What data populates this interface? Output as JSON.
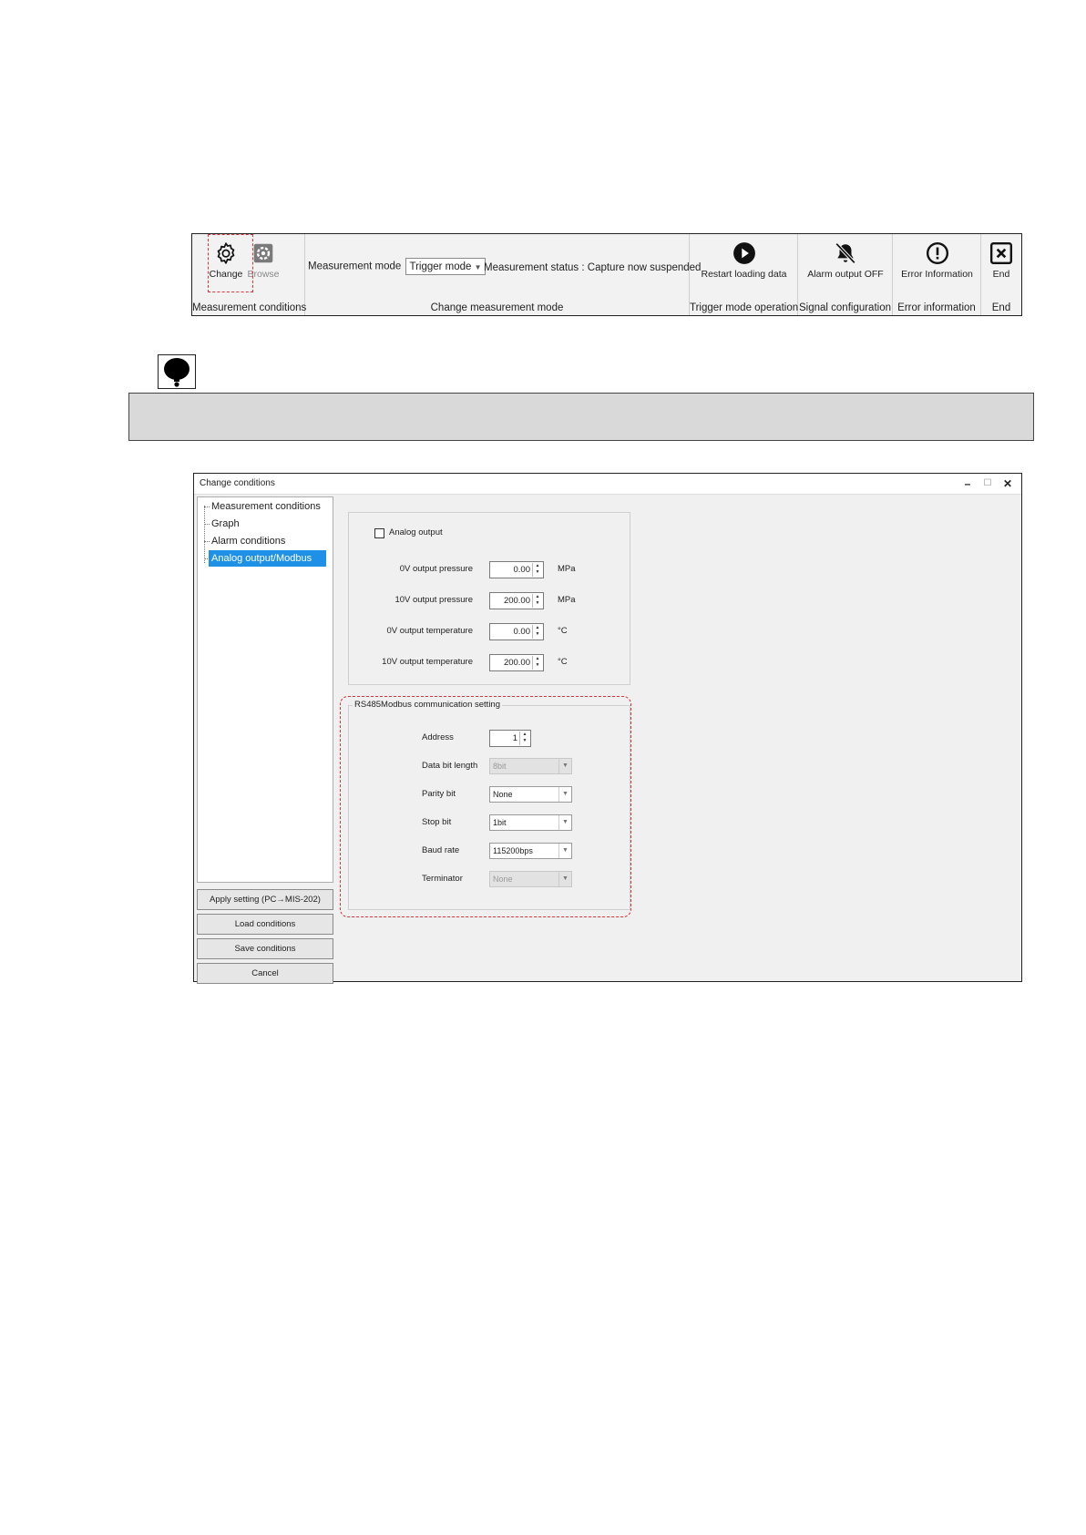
{
  "ribbon": {
    "change_label": "Change",
    "browse_label": "Browse",
    "group_measurement_conditions": "Measurement conditions",
    "measurement_mode_label": "Measurement mode",
    "measurement_mode_value": "Trigger mode",
    "measurement_status": "Measurement status : Capture now suspended",
    "group_change_measurement_mode": "Change measurement mode",
    "restart_label": "Restart loading data",
    "group_trigger_mode_operation": "Trigger mode operation",
    "alarm_label": "Alarm output OFF",
    "group_signal_configuration": "Signal configuration",
    "error_label": "Error Information",
    "group_error_information": "Error information",
    "end_label": "End",
    "group_end": "End"
  },
  "dialog": {
    "title": "Change conditions",
    "tree": [
      "Measurement conditions",
      "Graph",
      "Alarm conditions",
      "Analog output/Modbus"
    ],
    "buttons": {
      "apply": "Apply setting (PC→MIS-202)",
      "load": "Load conditions",
      "save": "Save conditions",
      "cancel": "Cancel"
    },
    "analog": {
      "checkbox_label": "Analog output",
      "checked": false,
      "rows": [
        {
          "label": "0V output pressure",
          "value": "0.00",
          "unit": "MPa"
        },
        {
          "label": "10V output pressure",
          "value": "200.00",
          "unit": "MPa"
        },
        {
          "label": "0V output temperature",
          "value": "0.00",
          "unit": "°C"
        },
        {
          "label": "10V output temperature",
          "value": "200.00",
          "unit": "°C"
        }
      ]
    },
    "rs485": {
      "legend": "RS485Modbus communication setting",
      "address_label": "Address",
      "address_value": "1",
      "data_bit_label": "Data bit length",
      "data_bit_value": "8bit",
      "parity_label": "Parity bit",
      "parity_value": "None",
      "stop_label": "Stop bit",
      "stop_value": "1bit",
      "baud_label": "Baud rate",
      "baud_value": "115200bps",
      "terminator_label": "Terminator",
      "terminator_value": "None"
    }
  },
  "colors": {
    "highlight": "#e0303a",
    "selection": "#1e90e6"
  }
}
